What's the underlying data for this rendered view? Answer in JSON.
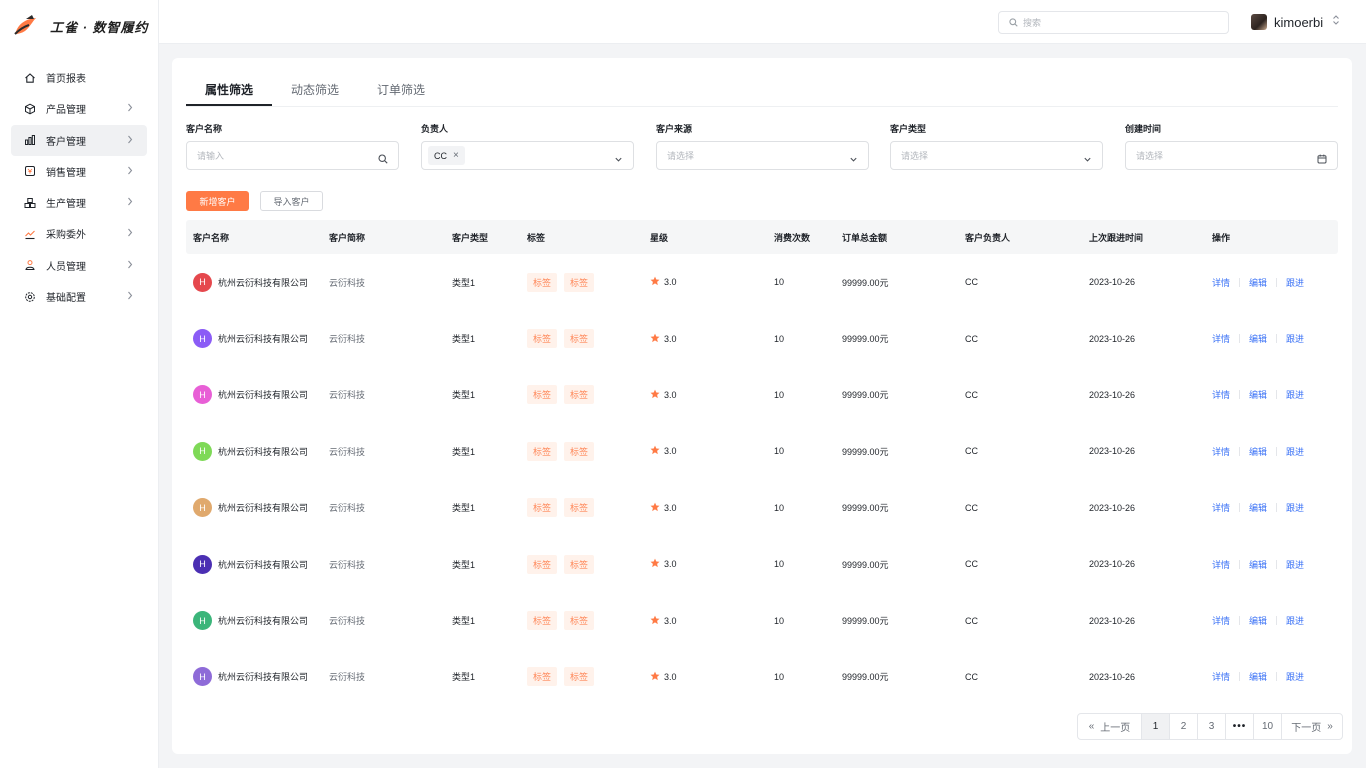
{
  "brand": {
    "name": "工雀 · 数智履约",
    "accent": "#ff7a45"
  },
  "sidebar": {
    "items": [
      {
        "label": "首页报表",
        "icon": "home-icon",
        "has_arrow": false,
        "active": false
      },
      {
        "label": "产品管理",
        "icon": "cube-icon",
        "has_arrow": true,
        "active": false
      },
      {
        "label": "客户管理",
        "icon": "chart-icon",
        "has_arrow": true,
        "active": true
      },
      {
        "label": "销售管理",
        "icon": "sales-icon",
        "has_arrow": true,
        "active": false
      },
      {
        "label": "生产管理",
        "icon": "boxes-icon",
        "has_arrow": true,
        "active": false
      },
      {
        "label": "采购委外",
        "icon": "purchase-icon",
        "has_arrow": true,
        "active": false
      },
      {
        "label": "人员管理",
        "icon": "person-icon",
        "has_arrow": true,
        "active": false
      },
      {
        "label": "基础配置",
        "icon": "settings-icon",
        "has_arrow": true,
        "active": false
      }
    ]
  },
  "topbar": {
    "search_placeholder": "搜索",
    "username": "kimoerbi"
  },
  "tabs": [
    {
      "label": "属性筛选",
      "active": true
    },
    {
      "label": "动态筛选",
      "active": false
    },
    {
      "label": "订单筛选",
      "active": false
    }
  ],
  "filters": {
    "customer_name": {
      "label": "客户名称",
      "placeholder": "请输入"
    },
    "owner": {
      "label": "负责人",
      "chip": "CC"
    },
    "source": {
      "label": "客户来源",
      "placeholder": "请选择"
    },
    "type": {
      "label": "客户类型",
      "placeholder": "请选择"
    },
    "created": {
      "label": "创建时间",
      "placeholder": "请选择"
    }
  },
  "actions": {
    "add_label": "新增客户",
    "import_label": "导入客户"
  },
  "table": {
    "columns": [
      "客户名称",
      "客户简称",
      "客户类型",
      "标签",
      "星级",
      "消费次数",
      "订单总金额",
      "客户负责人",
      "上次跟进时间",
      "操作"
    ],
    "rows": [
      {
        "avatar": "H",
        "avatar_color": "#e5484d",
        "name": "杭州云衍科技有限公司",
        "short": "云衍科技",
        "type": "类型1",
        "tags": [
          "标签",
          "标签"
        ],
        "star": "3.0",
        "count": "10",
        "amount": "99999.00元",
        "owner": "CC",
        "date": "2023-10-26"
      },
      {
        "avatar": "H",
        "avatar_color": "#8b5cf6",
        "name": "杭州云衍科技有限公司",
        "short": "云衍科技",
        "type": "类型1",
        "tags": [
          "标签",
          "标签"
        ],
        "star": "3.0",
        "count": "10",
        "amount": "99999.00元",
        "owner": "CC",
        "date": "2023-10-26"
      },
      {
        "avatar": "H",
        "avatar_color": "#e85fd6",
        "name": "杭州云衍科技有限公司",
        "short": "云衍科技",
        "type": "类型1",
        "tags": [
          "标签",
          "标签"
        ],
        "star": "3.0",
        "count": "10",
        "amount": "99999.00元",
        "owner": "CC",
        "date": "2023-10-26"
      },
      {
        "avatar": "H",
        "avatar_color": "#7ed957",
        "name": "杭州云衍科技有限公司",
        "short": "云衍科技",
        "type": "类型1",
        "tags": [
          "标签",
          "标签"
        ],
        "star": "3.0",
        "count": "10",
        "amount": "99999.00元",
        "owner": "CC",
        "date": "2023-10-26"
      },
      {
        "avatar": "H",
        "avatar_color": "#e0a96d",
        "name": "杭州云衍科技有限公司",
        "short": "云衍科技",
        "type": "类型1",
        "tags": [
          "标签",
          "标签"
        ],
        "star": "3.0",
        "count": "10",
        "amount": "99999.00元",
        "owner": "CC",
        "date": "2023-10-26"
      },
      {
        "avatar": "H",
        "avatar_color": "#4b2fb3",
        "name": "杭州云衍科技有限公司",
        "short": "云衍科技",
        "type": "类型1",
        "tags": [
          "标签",
          "标签"
        ],
        "star": "3.0",
        "count": "10",
        "amount": "99999.00元",
        "owner": "CC",
        "date": "2023-10-26"
      },
      {
        "avatar": "H",
        "avatar_color": "#3bb57a",
        "name": "杭州云衍科技有限公司",
        "short": "云衍科技",
        "type": "类型1",
        "tags": [
          "标签",
          "标签"
        ],
        "star": "3.0",
        "count": "10",
        "amount": "99999.00元",
        "owner": "CC",
        "date": "2023-10-26"
      },
      {
        "avatar": "H",
        "avatar_color": "#8e6bd8",
        "name": "杭州云衍科技有限公司",
        "short": "云衍科技",
        "type": "类型1",
        "tags": [
          "标签",
          "标签"
        ],
        "star": "3.0",
        "count": "10",
        "amount": "99999.00元",
        "owner": "CC",
        "date": "2023-10-26"
      }
    ],
    "row_actions": [
      "详情",
      "编辑",
      "跟进"
    ]
  },
  "pagination": {
    "prev_label": "上一页",
    "next_label": "下一页",
    "pages": [
      "1",
      "2",
      "3",
      "•••",
      "10"
    ],
    "current": "1"
  }
}
